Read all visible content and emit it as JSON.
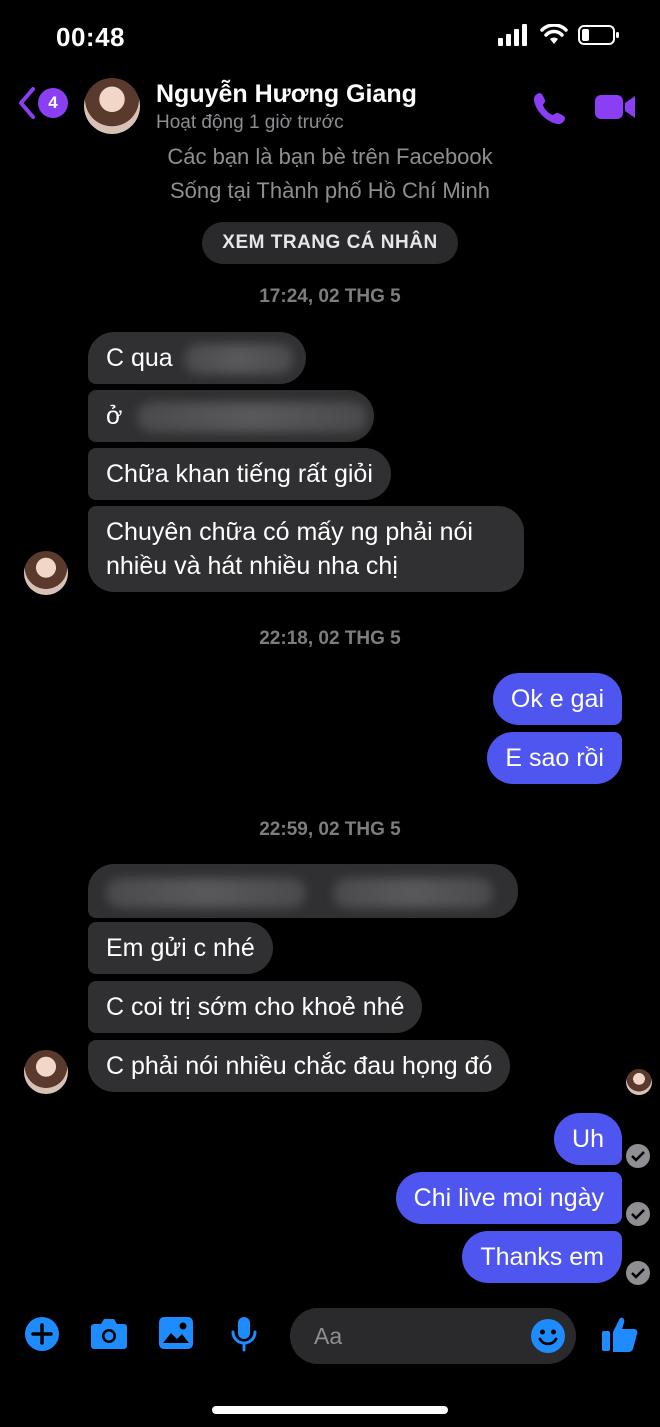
{
  "status_bar": {
    "time": "00:48"
  },
  "header": {
    "back_badge": "4",
    "contact_name": "Nguyễn Hương Giang",
    "contact_status": "Hoạt động 1 giờ trước"
  },
  "profile_info": {
    "line1": "Các bạn là bạn bè trên Facebook",
    "line2": "Sống tại Thành phố Hồ Chí Minh",
    "button": "XEM TRANG CÁ NHÂN"
  },
  "timestamps": [
    "17:24, 02 THG 5",
    "22:18, 02 THG 5",
    "22:59, 02 THG 5"
  ],
  "messages": {
    "m1_prefix": "C qua",
    "m2_prefix": "ở",
    "m3": "Chữa khan tiếng rất giỏi",
    "m4_line1": "Chuyên chữa có mấy ng phải nói",
    "m4_line2": "nhiều và hát nhiều nha chị",
    "o1": "Ok e gai",
    "o2": "E sao rồi",
    "m6": "Em gửi c nhé",
    "m7": "C coi trị sớm cho khoẻ nhé",
    "m8": "C phải nói nhiều chắc đau họng đó",
    "o3": "Uh",
    "o4": "Chi live moi ngày",
    "o5": "Thanks em"
  },
  "composer": {
    "placeholder": "Aa"
  },
  "colors": {
    "accent": "#8a3ff5",
    "outgoing_bubble": "#4f56f0",
    "incoming_bubble": "#303032",
    "icon_blue": "#1e8cff"
  }
}
